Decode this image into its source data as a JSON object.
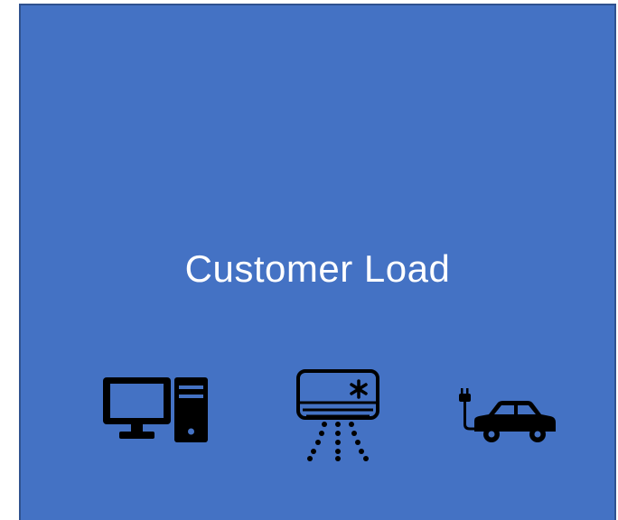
{
  "panel": {
    "title": "Customer Load",
    "background": "#4472c4",
    "border": "#2f528f",
    "text_color": "#ffffff"
  },
  "icons": [
    {
      "name": "computer-icon"
    },
    {
      "name": "air-conditioner-icon"
    },
    {
      "name": "electric-car-icon"
    }
  ]
}
